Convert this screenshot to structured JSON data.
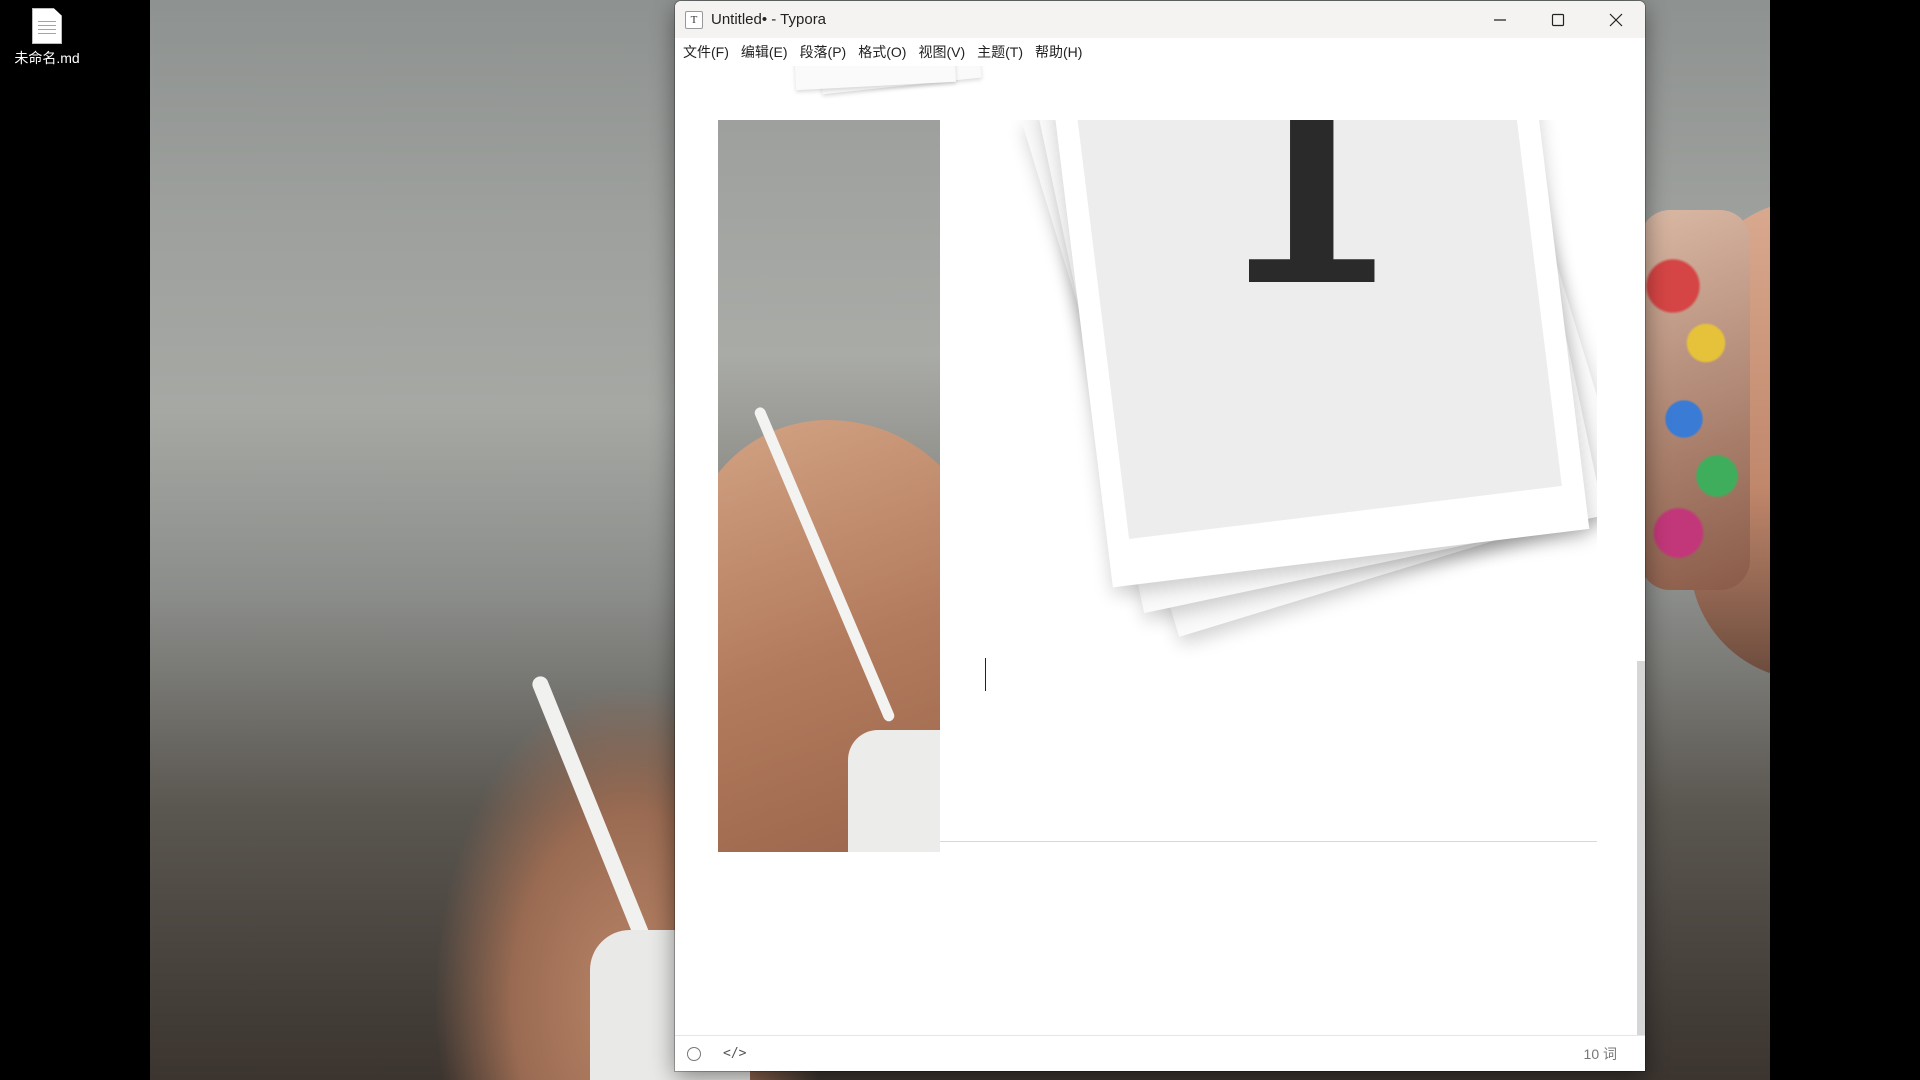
{
  "desktop": {
    "file_label": "未命名.md",
    "file_icon": "document-icon"
  },
  "window": {
    "title": "Untitled• - Typora",
    "app_icon_letter": "T",
    "controls": {
      "minimize_icon": "minimize-icon",
      "maximize_icon": "maximize-icon",
      "close_icon": "close-icon"
    }
  },
  "menu": {
    "items": [
      {
        "label": "文件(F)"
      },
      {
        "label": "编辑(E)"
      },
      {
        "label": "段落(P)"
      },
      {
        "label": "格式(O)"
      },
      {
        "label": "视图(V)"
      },
      {
        "label": "主题(T)"
      },
      {
        "label": "帮助(H)"
      }
    ]
  },
  "editor": {
    "logo_letter": "T"
  },
  "statusbar": {
    "sidebar_toggle_icon": "circle-icon",
    "source_toggle_label": "</>",
    "word_count": "10 词"
  },
  "colors": {
    "titlebar_bg": "#f5f3f1",
    "desktop_bg": "#000000",
    "text": "#222222"
  }
}
